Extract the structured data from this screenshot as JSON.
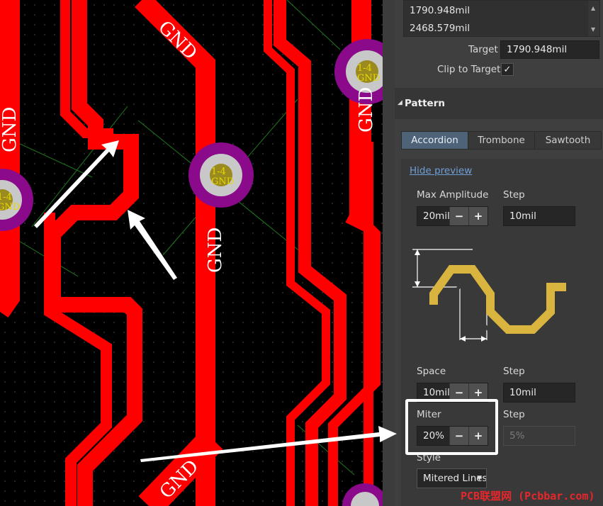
{
  "pcb": {
    "net_labels": [
      "GND",
      "GND",
      "GND",
      "GND",
      "GND"
    ],
    "pads": [
      {
        "designator": "1-4",
        "net": "GND"
      },
      {
        "designator": "1-4",
        "net": "GND"
      },
      {
        "designator": "1-4",
        "net": "GND"
      }
    ]
  },
  "panel": {
    "length_list": [
      "1790.948mil",
      "2468.579mil"
    ],
    "target_label": "Target",
    "target_value": "1790.948mil",
    "clip_label": "Clip to Target",
    "clip_checked": "✓",
    "pattern_header": "Pattern",
    "tabs": [
      "Accordion",
      "Trombone",
      "Sawtooth"
    ],
    "active_tab": "Accordion",
    "hide_preview": "Hide preview",
    "max_amplitude_label": "Max Amplitude",
    "max_amplitude_value": "20mil",
    "amp_step_label": "Step",
    "amp_step_value": "10mil",
    "space_label": "Space",
    "space_value": "10mil",
    "space_step_label": "Step",
    "space_step_value": "10mil",
    "miter_label": "Miter",
    "miter_value": "20%",
    "miter_step_label": "Step",
    "miter_step_value": "5%",
    "style_label": "Style",
    "style_value": "Mitered Lines",
    "minus": "−",
    "plus": "+"
  },
  "watermark": "PCB联盟网 (Pcbbar.com)",
  "colors": {
    "track": "#ff0000",
    "pad_ring": "#8b0a8b",
    "pad_fill": "#c8c8c8",
    "pad_text": "#e8d800",
    "panel_bg": "#3f3f3f",
    "active_tab": "#4e6378",
    "accent_link": "#6f9fd8",
    "preview_trace": "#d9b540"
  }
}
